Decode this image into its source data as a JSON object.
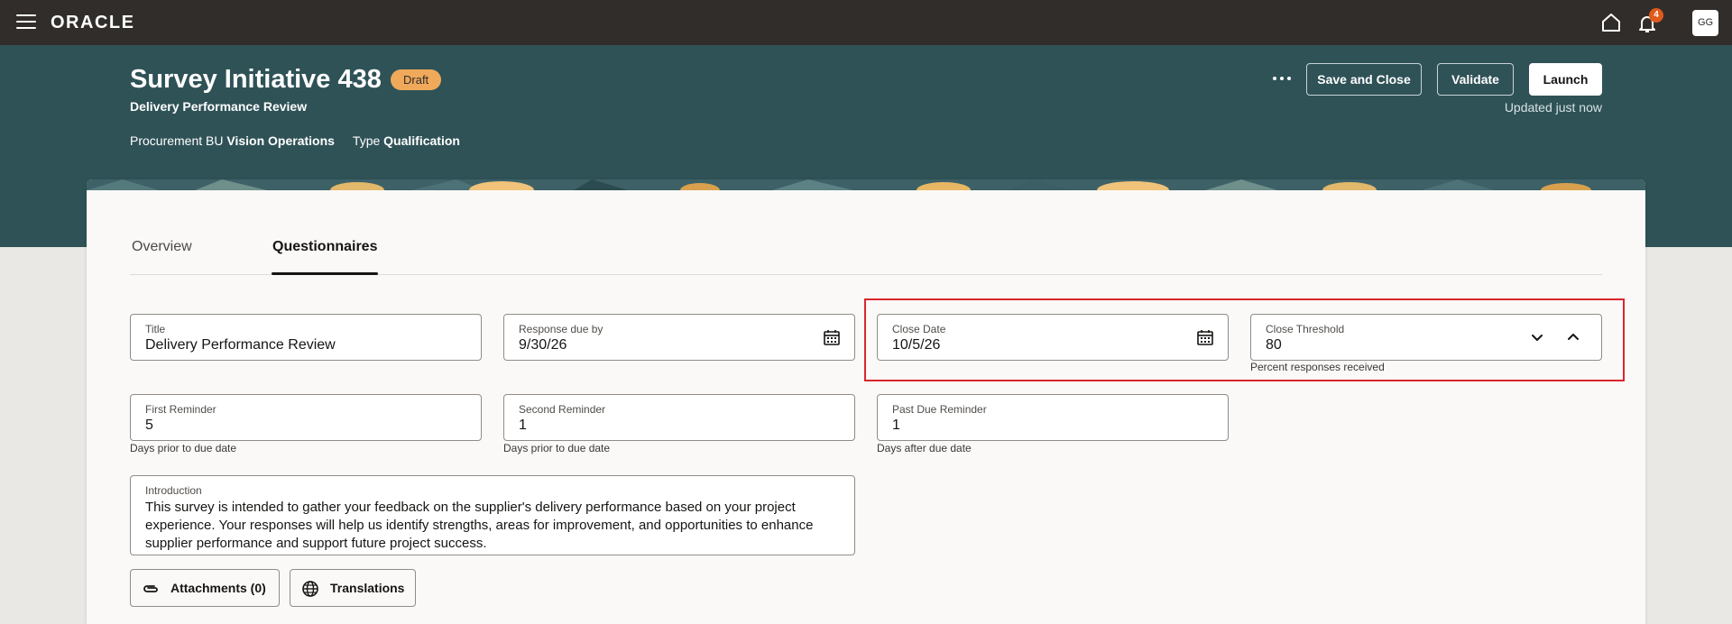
{
  "nav": {
    "logo": "ORACLE",
    "notification_count": "4",
    "avatar_initials": "GG"
  },
  "header": {
    "title": "Survey Initiative 438",
    "status": "Draft",
    "subtitle": "Delivery Performance Review",
    "procurement_bu_label": "Procurement BU",
    "procurement_bu_value": "Vision Operations",
    "type_label": "Type",
    "type_value": "Qualification",
    "save_close_label": "Save and Close",
    "validate_label": "Validate",
    "launch_label": "Launch",
    "updated_text": "Updated just now"
  },
  "tabs": [
    {
      "label": "Overview",
      "active": false
    },
    {
      "label": "Questionnaires",
      "active": true
    }
  ],
  "form": {
    "title": {
      "label": "Title",
      "value": "Delivery Performance Review"
    },
    "response_due": {
      "label": "Response due by",
      "value": "9/30/26"
    },
    "close_date": {
      "label": "Close Date",
      "value": "10/5/26"
    },
    "close_threshold": {
      "label": "Close Threshold",
      "value": "80",
      "help": "Percent responses received"
    },
    "first_reminder": {
      "label": "First Reminder",
      "value": "5",
      "help": "Days prior to due date"
    },
    "second_reminder": {
      "label": "Second Reminder",
      "value": "1",
      "help": "Days prior to due date"
    },
    "past_due_reminder": {
      "label": "Past Due Reminder",
      "value": "1",
      "help": "Days after due date"
    },
    "introduction": {
      "label": "Introduction",
      "value": "This survey is intended to gather your feedback on the supplier's delivery performance based on your project experience. Your responses will help us identify strengths, areas for improvement, and opportunities to enhance supplier performance and support future project success."
    }
  },
  "actions": {
    "attachments_label": "Attachments (0)",
    "translations_label": "Translations"
  },
  "colors": {
    "topbar": "#312d2a",
    "header_band": "#2f5257",
    "draft_badge": "#f0a95a",
    "highlight": "#d8262e",
    "notification_badge": "#e05a1b"
  }
}
